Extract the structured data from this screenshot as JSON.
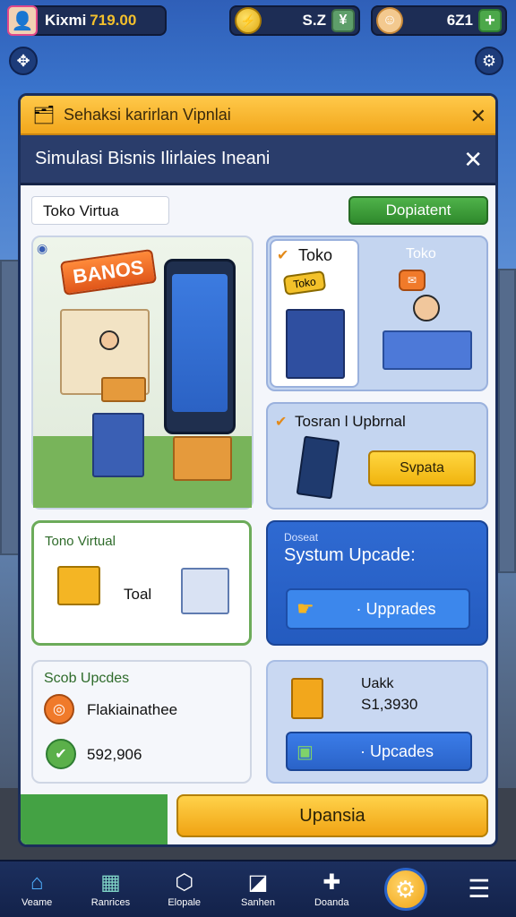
{
  "hud": {
    "user_name": "Kixmi",
    "user_value": "719.00",
    "coins": "S.Z",
    "gems": "6Z1",
    "plus_glyph": "+"
  },
  "window": {
    "outer_title": "Sehaksi karirlan Vipnlai",
    "inner_title": "Simulasi Bisnis Ilirlaies Ineani",
    "close_glyph": "✕"
  },
  "toolbar": {
    "field_value": "Toko Virtua",
    "button_label": "Dopiatent"
  },
  "cards": {
    "hero_banner": "BANOS",
    "toko_label": "Toko",
    "toko_label_2": "Toko",
    "toko_sign": "Toko",
    "tosran_title": "Tosran l Upbrnal",
    "tosran_button": "Svpata",
    "toko_virtual_title": "Tono Virtual",
    "toko_virtual_value": "Toal",
    "system_kicker": "Doseat",
    "system_title": "Systum Upcade:",
    "system_button": "· Upprades",
    "scob_title": "Scob Upcdes",
    "scob_item_1": "Flakiainathee",
    "scob_item_2": "592,906",
    "uakk_title": "Uakk",
    "uakk_value": "S1,3930",
    "uakk_button": "· Upcades"
  },
  "cta_label": "Upansia",
  "nav": [
    {
      "label": "Veame",
      "icon": "home-icon"
    },
    {
      "label": "Ranrices",
      "icon": "store-icon"
    },
    {
      "label": "Elopale",
      "icon": "box-icon"
    },
    {
      "label": "Sanhen",
      "icon": "chart-icon"
    },
    {
      "label": "Doanda",
      "icon": "puzzle-icon"
    },
    {
      "label": "",
      "icon": "gear-icon"
    },
    {
      "label": "",
      "icon": "menu-icon"
    }
  ],
  "colors": {
    "accent_orange": "#f2a71c",
    "header_navy": "#2a3d6b",
    "cta_green": "#2f8a2c",
    "system_blue": "#2a63c8"
  }
}
